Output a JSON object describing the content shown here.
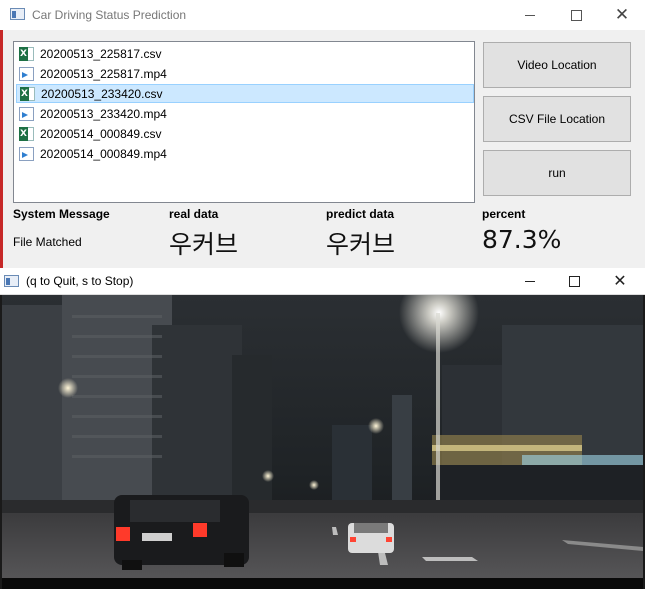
{
  "main_window": {
    "title": "Car Driving Status Prediction",
    "files": [
      {
        "name": "20200513_225817.csv",
        "type": "csv",
        "selected": false
      },
      {
        "name": "20200513_225817.mp4",
        "type": "mp4",
        "selected": false
      },
      {
        "name": "20200513_233420.csv",
        "type": "csv",
        "selected": true
      },
      {
        "name": "20200513_233420.mp4",
        "type": "mp4",
        "selected": false
      },
      {
        "name": "20200514_000849.csv",
        "type": "csv",
        "selected": false
      },
      {
        "name": "20200514_000849.mp4",
        "type": "mp4",
        "selected": false
      }
    ],
    "buttons": {
      "video_location": "Video Location",
      "csv_location": "CSV File Location",
      "run": "run"
    },
    "status": {
      "system_message_label": "System Message",
      "system_message_value": "File Matched",
      "real_data_label": "real data",
      "real_data_value": "우커브",
      "predict_data_label": "predict data",
      "predict_data_value": "우커브",
      "percent_label": "percent",
      "percent_value": "87.3%"
    }
  },
  "video_window": {
    "title": "(q to Quit, s to Stop)"
  },
  "colors": {
    "selection_bg": "#cce8ff",
    "selection_border": "#99d1ff",
    "button_bg": "#e1e1e1",
    "window_bg": "#f0f0f0",
    "csv_icon": "#1d7044",
    "mp4_icon": "#2f7fd0"
  }
}
